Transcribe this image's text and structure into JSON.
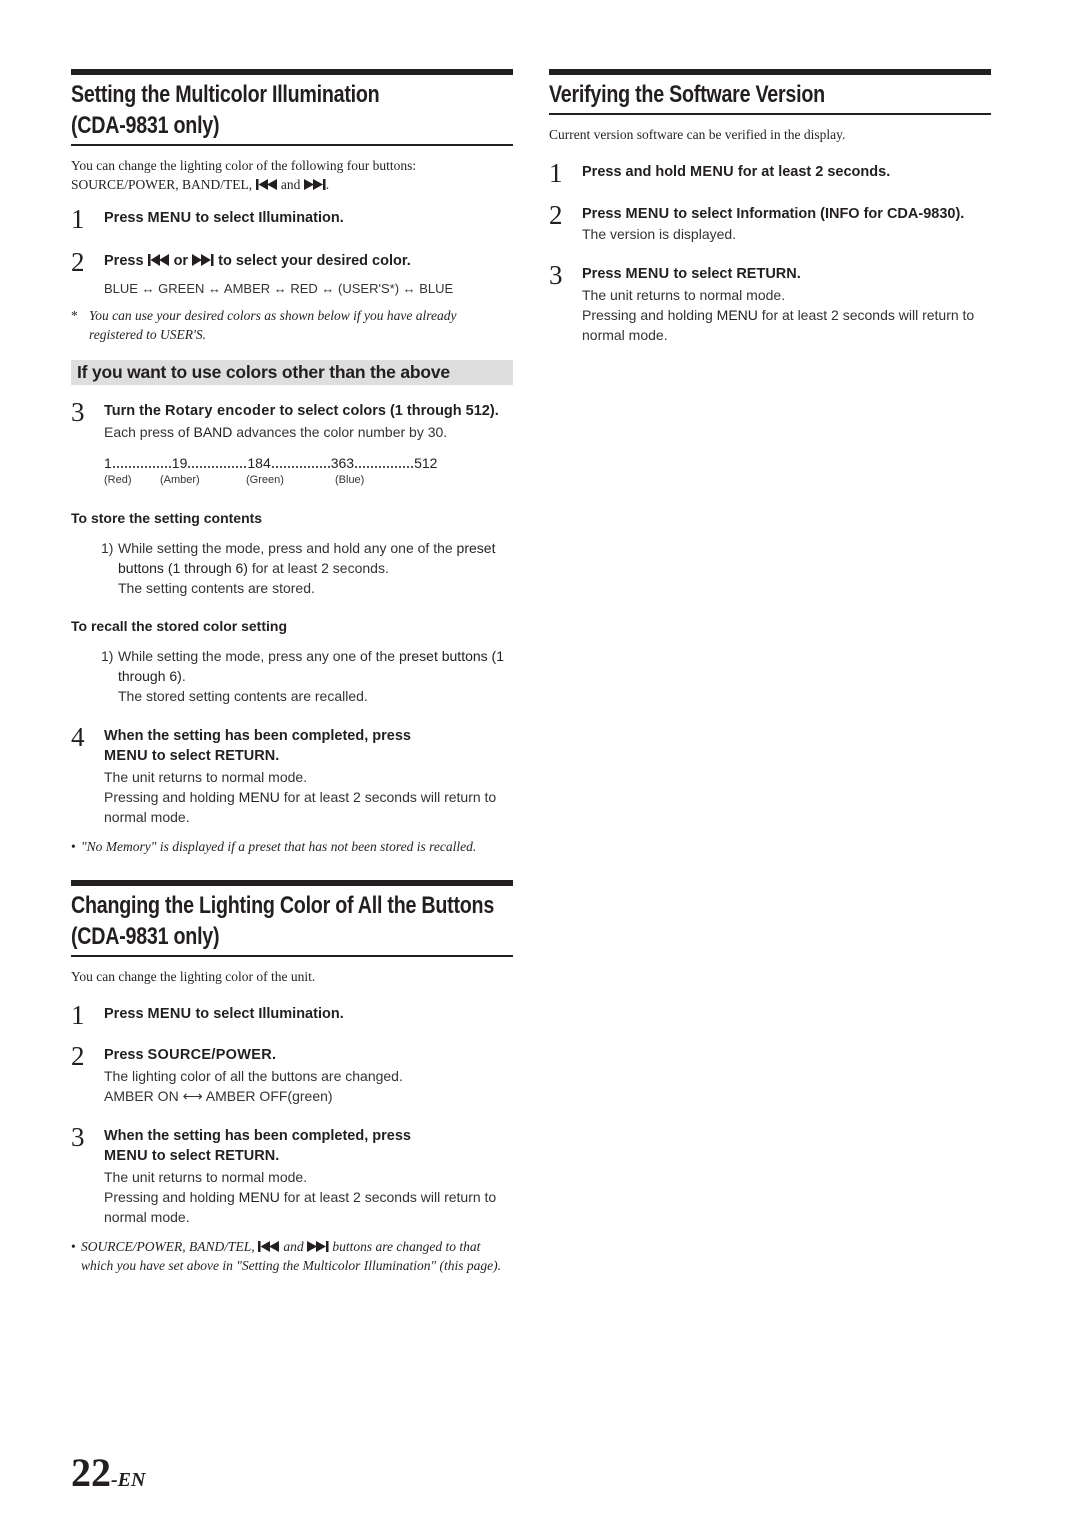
{
  "left_column": {
    "section1": {
      "title_line1": "Setting the Multicolor Illumination",
      "title_line2": "(CDA-9831 only)",
      "intro_line1": "You can change the lighting color of the following four buttons:",
      "intro_line2_prefix": "SOURCE/POWER, BAND/TEL,",
      "intro_line2_and": "and",
      "intro_line2_end": ".",
      "steps": [
        {
          "num": "1",
          "pre": "Press ",
          "kw": "MENU",
          "post": " to select Illumination."
        },
        {
          "num": "2",
          "pre": "Press ",
          "mid": " or ",
          "post": " to select your desired color."
        }
      ],
      "color_sequence": "BLUE ↔ GREEN ↔ AMBER ↔ RED ↔ (USER'S*) ↔ BLUE",
      "footnote_mark": "*",
      "footnote": "You can use your desired colors as shown below if you have already registered to USER'S.",
      "band_title": "If you want to use colors other than the above",
      "step3": {
        "num": "3",
        "pre": "Turn the ",
        "kw": "Rotary encoder",
        "post": " to select colors (1 through 512).",
        "body_pre": "Each press of ",
        "body_kw": "BAND",
        "body_post": " advances the color number by 30."
      },
      "color_scale": {
        "values": [
          "1",
          "19",
          "184",
          "363",
          "512"
        ],
        "labels": [
          "(Red)",
          "(Amber)",
          "(Green)",
          "(Blue)"
        ]
      },
      "store": {
        "heading": "To store the setting contents",
        "num": "1)",
        "line_pre": "While setting the mode, press and hold any one of the ",
        "line_kw": "preset buttons (1 through 6)",
        "line_post": " for at least 2 seconds.",
        "result": "The setting contents are stored."
      },
      "recall": {
        "heading": "To recall the stored color setting",
        "num": "1)",
        "line_pre": "While setting the mode, press any one of the ",
        "line_kw": "preset buttons (1 through 6)",
        "line_post": ".",
        "result": "The stored setting contents are recalled."
      },
      "step4": {
        "num": "4",
        "line1": "When the setting has been completed, press",
        "kw": "MENU",
        "post": " to select RETURN.",
        "body1": "The unit returns to normal mode.",
        "body2_pre": "Pressing and holding ",
        "body2_kw": "MENU",
        "body2_post": " for at least 2 seconds will return to normal mode."
      },
      "bullet_mark": "•",
      "bullet_note": "\"No Memory\" is displayed if a preset that has not been stored is recalled."
    },
    "section2": {
      "title_line1": "Changing the Lighting Color of All the Buttons",
      "title_line2": "(CDA-9831 only)",
      "intro": "You can change the lighting color of the unit.",
      "step1": {
        "num": "1",
        "pre": "Press ",
        "kw": "MENU",
        "post": " to select Illumination."
      },
      "step2": {
        "num": "2",
        "pre": "Press ",
        "kw": "SOURCE/POWER",
        "post": ".",
        "body1": "The lighting color of all the buttons are changed.",
        "body2": "AMBER ON ⟷ AMBER OFF(green)"
      },
      "step3": {
        "num": "3",
        "line1": "When the setting has been completed, press",
        "kw": "MENU",
        "post": " to select RETURN.",
        "body1": "The unit returns to normal mode.",
        "body2_pre": "Pressing and holding ",
        "body2_kw": "MENU",
        "body2_post": " for at least 2 seconds will return to normal mode."
      },
      "bullet_mark": "•",
      "bullet_pre": "SOURCE/POWER, BAND/TEL,",
      "bullet_and": "and",
      "bullet_post": "buttons are changed to that which you have set above in \"Setting the Multicolor Illumination\" (this page)."
    }
  },
  "right_column": {
    "title": "Verifying the Software Version",
    "intro": "Current version software can be verified in the display.",
    "step1": {
      "num": "1",
      "pre": "Press and hold ",
      "kw": "MENU",
      "post": " for at least 2 seconds."
    },
    "step2": {
      "num": "2",
      "pre": "Press ",
      "kw": "MENU",
      "post": " to select Information (INFO for CDA-9830).",
      "body": "The version is displayed."
    },
    "step3": {
      "num": "3",
      "pre": "Press ",
      "kw": "MENU",
      "post": " to select RETURN.",
      "body1": "The unit returns to normal mode.",
      "body2_pre": "Pressing and holding ",
      "body2_kw": "MENU",
      "body2_post": " for at least 2 seconds will return to normal mode."
    }
  },
  "footer": {
    "page_number": "22",
    "page_suffix": "-EN"
  }
}
